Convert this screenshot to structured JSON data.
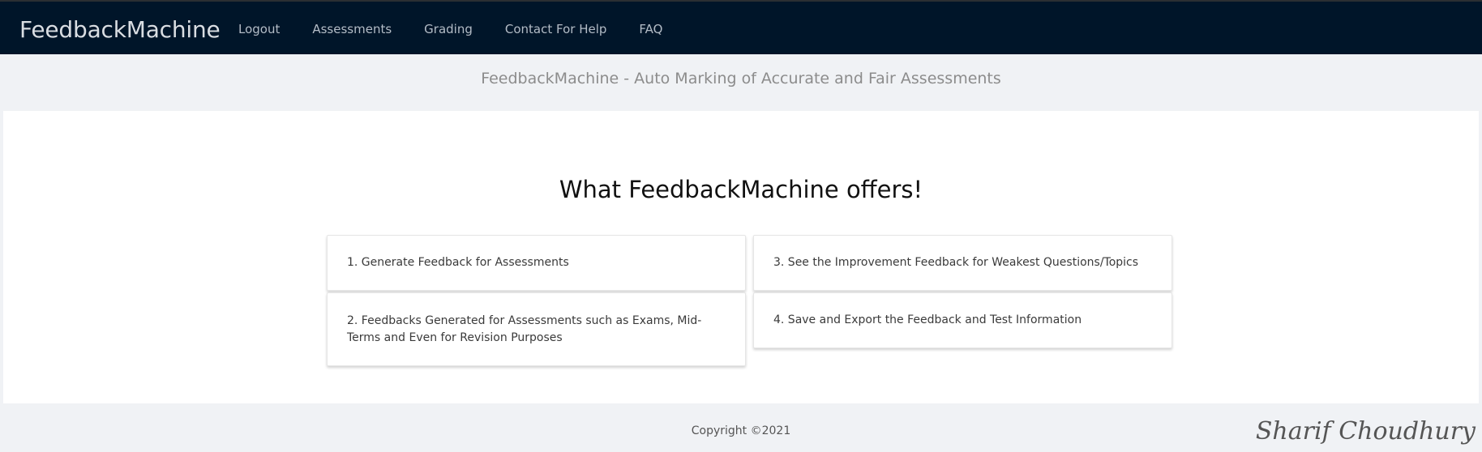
{
  "header": {
    "brand": "FeedbackMachine",
    "nav": [
      "Logout",
      "Assessments",
      "Grading",
      "Contact For Help",
      "FAQ"
    ]
  },
  "subtitle": "FeedbackMachine - Auto Marking of Accurate and Fair Assessments",
  "main": {
    "heading": "What FeedbackMachine offers!",
    "cards": [
      "1. Generate Feedback for Assessments",
      "2. Feedbacks Generated for Assessments such as Exams, Mid-Terms and Even for Revision Purposes",
      "3. See the Improvement Feedback for Weakest Questions/Topics",
      "4. Save and Export the Feedback and Test Information"
    ]
  },
  "footer": {
    "copyright": "Copyright ©2021",
    "signature": "Sharif Choudhury"
  }
}
